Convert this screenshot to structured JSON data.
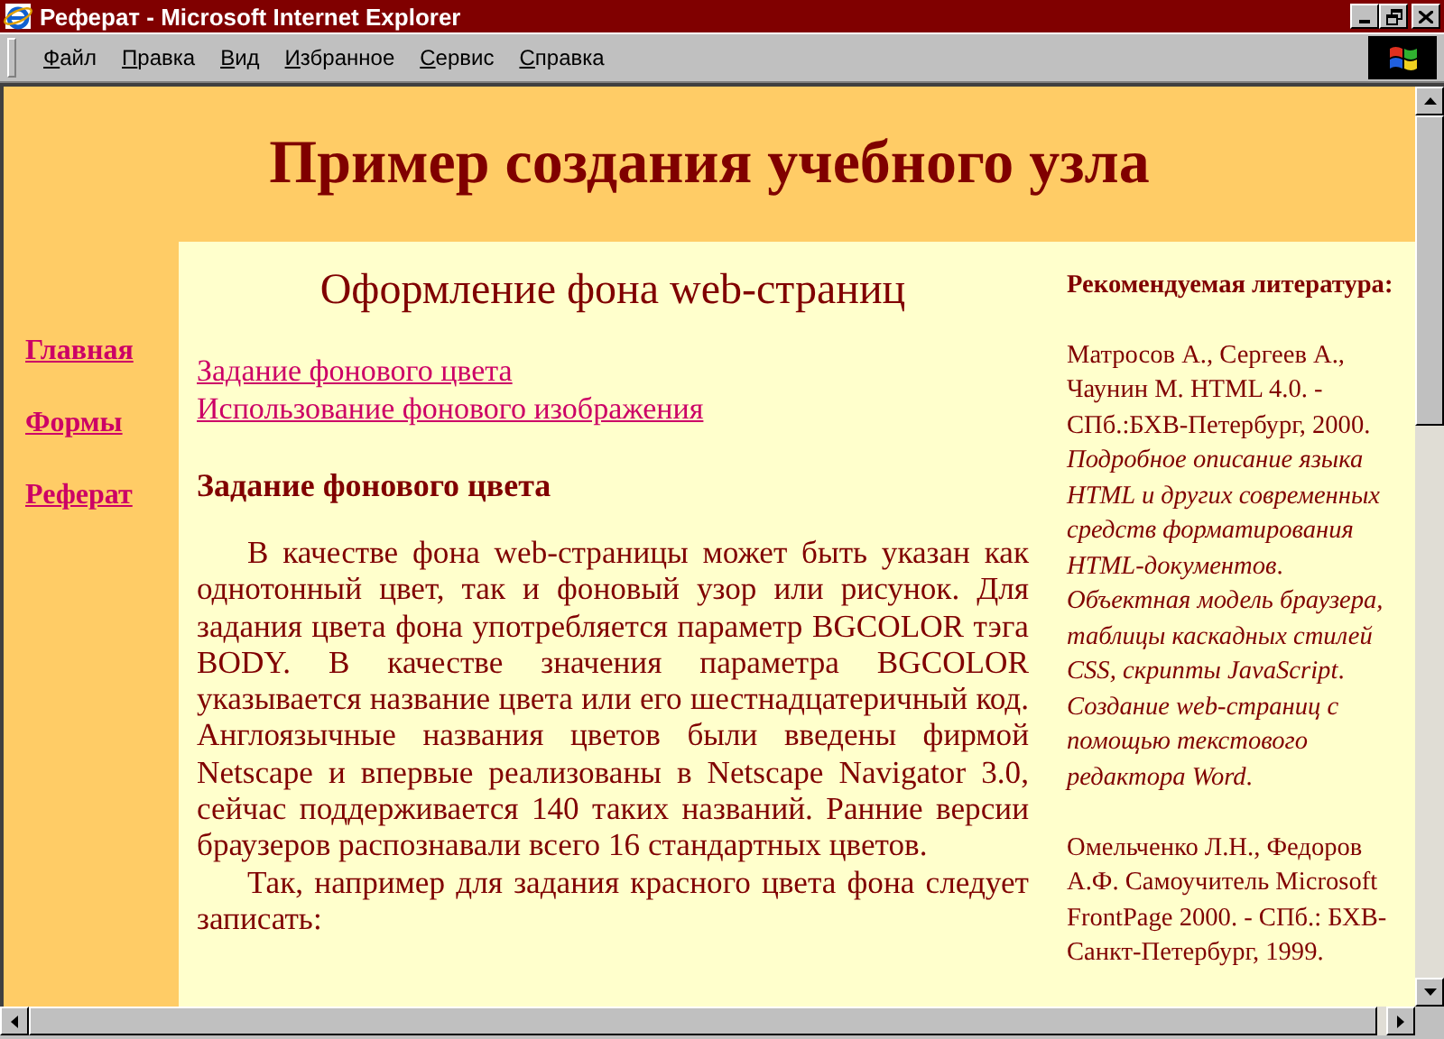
{
  "window": {
    "title": "Реферат - Microsoft Internet Explorer"
  },
  "menu": [
    "Файл",
    "Правка",
    "Вид",
    "Избранное",
    "Сервис",
    "Справка"
  ],
  "page": {
    "heading": "Пример создания учебного узла",
    "nav": [
      {
        "label": "Главная"
      },
      {
        "label": "Формы"
      },
      {
        "label": "Реферат"
      }
    ],
    "main": {
      "title": "Оформление фона web-страниц",
      "links": [
        "Задание фонового цвета",
        "Использование фонового изображения"
      ],
      "section_heading": "Задание фонового цвета",
      "paragraphs": [
        "В качестве фона web-страницы может быть указан как однотонный цвет, так и фоновый узор или рисунок. Для задания цвета фона употребляется параметр BGCOLOR тэга BODY. В качестве значения параметра BGCOLOR указывается название цвета или его шестнадцатеричный код. Англоязычные названия цветов были введены фирмой Netscape и впервые реализованы в Netscape Navigator 3.0, сейчас поддерживается 140 таких названий. Ранние версии браузеров распознавали всего 16 стандартных цветов.",
        "Так, например для задания красного цвета фона следует записать:"
      ]
    },
    "sidebar": {
      "heading": "Рекомендуемая литература:",
      "entries": [
        "Матросов А., Сергеев А., Чаунин М. HTML 4.0. - СПб.:БХВ-Петербург, 2000. *Подробное описание языка HTML и других современных средств форматирования HTML-документов*. *Объектная модель браузера, таблицы каскадных стилей CSS, скрипты JavaScript*. *Создание web-страниц с помощью текстового редактора Word*.",
        "Омельченко Л.Н., Федоров А.Ф. Самоучитель Microsoft FrontPage 2000. - СПб.: БХВ-Санкт-Петербург, 1999."
      ]
    }
  }
}
